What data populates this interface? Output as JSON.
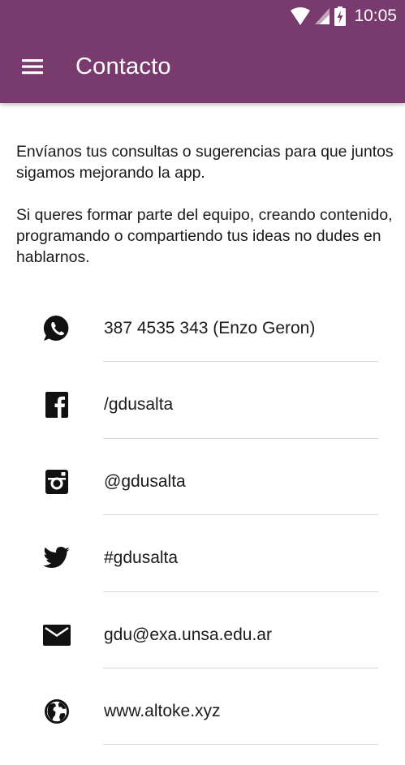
{
  "status_bar": {
    "time": "10:05",
    "icons": [
      "wifi-icon",
      "cell-signal-icon",
      "battery-charging-icon"
    ]
  },
  "app_bar": {
    "title": "Contacto",
    "menu_icon": "menu-icon",
    "background_color": "#793a6e"
  },
  "intro": {
    "paragraph_1": "Envíanos tus consultas o sugerencias para que juntos sigamos mejorando la app.",
    "paragraph_2": "Si queres formar parte del equipo, creando contenido, programando o compartiendo tus ideas no dudes en hablarnos."
  },
  "contacts": [
    {
      "icon": "whatsapp-icon",
      "label": "387 4535 343 (Enzo Geron)"
    },
    {
      "icon": "facebook-icon",
      "label": "/gdusalta"
    },
    {
      "icon": "instagram-icon",
      "label": "@gdusalta"
    },
    {
      "icon": "twitter-icon",
      "label": "#gdusalta"
    },
    {
      "icon": "email-icon",
      "label": "gdu@exa.unsa.edu.ar"
    },
    {
      "icon": "globe-icon",
      "label": "www.altoke.xyz"
    }
  ]
}
